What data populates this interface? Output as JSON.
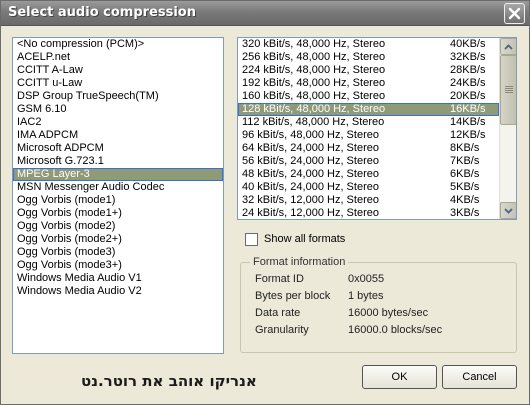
{
  "window": {
    "title": "Select audio compression",
    "close_icon": "close-icon"
  },
  "codecs": [
    "<No compression (PCM)>",
    "ACELP.net",
    "CCITT A-Law",
    "CCITT u-Law",
    "DSP Group TrueSpeech(TM)",
    "GSM 6.10",
    "IAC2",
    "IMA ADPCM",
    "Microsoft ADPCM",
    "Microsoft G.723.1",
    "MPEG Layer-3",
    "MSN Messenger Audio Codec",
    "Ogg Vorbis (mode1)",
    "Ogg Vorbis (mode1+)",
    "Ogg Vorbis (mode2)",
    "Ogg Vorbis (mode2+)",
    "Ogg Vorbis (mode3)",
    "Ogg Vorbis (mode3+)",
    "Windows Media Audio V1",
    "Windows Media Audio V2"
  ],
  "selected_codec_index": 10,
  "formats": [
    {
      "format": "320 kBit/s, 48,000 Hz, Stereo",
      "size": "40KB/s"
    },
    {
      "format": "256 kBit/s, 48,000 Hz, Stereo",
      "size": "32KB/s"
    },
    {
      "format": "224 kBit/s, 48,000 Hz, Stereo",
      "size": "28KB/s"
    },
    {
      "format": "192 kBit/s, 48,000 Hz, Stereo",
      "size": "24KB/s"
    },
    {
      "format": "160 kBit/s, 48,000 Hz, Stereo",
      "size": "20KB/s"
    },
    {
      "format": "128 kBit/s, 48,000 Hz, Stereo",
      "size": "16KB/s"
    },
    {
      "format": "112 kBit/s, 48,000 Hz, Stereo",
      "size": "14KB/s"
    },
    {
      "format": "96 kBit/s, 48,000 Hz, Stereo",
      "size": "12KB/s"
    },
    {
      "format": "64 kBit/s, 24,000 Hz, Stereo",
      "size": "8KB/s"
    },
    {
      "format": "56 kBit/s, 24,000 Hz, Stereo",
      "size": "7KB/s"
    },
    {
      "format": "48 kBit/s, 24,000 Hz, Stereo",
      "size": "6KB/s"
    },
    {
      "format": "40 kBit/s, 24,000 Hz, Stereo",
      "size": "5KB/s"
    },
    {
      "format": "32 kBit/s, 12,000 Hz, Stereo",
      "size": "4KB/s"
    },
    {
      "format": "24 kBit/s, 12,000 Hz, Stereo",
      "size": "3KB/s"
    }
  ],
  "selected_format_index": 5,
  "show_all_formats": {
    "label": "Show all formats",
    "checked": false
  },
  "format_info": {
    "title": "Format information",
    "rows": [
      {
        "label": "Format ID",
        "value": "0x0055"
      },
      {
        "label": "Bytes per block",
        "value": "1 bytes"
      },
      {
        "label": "Data rate",
        "value": "16000 bytes/sec"
      },
      {
        "label": "Granularity",
        "value": "16000.0 blocks/sec"
      }
    ]
  },
  "buttons": {
    "ok": "OK",
    "cancel": "Cancel"
  },
  "watermark": "אנריקו אוהב את רוטר.נט",
  "colors": {
    "selection": "#8f9a76",
    "selection_border": "#3a6fd8",
    "face": "#ece9d8",
    "titlebar": "#7a7a7a"
  }
}
